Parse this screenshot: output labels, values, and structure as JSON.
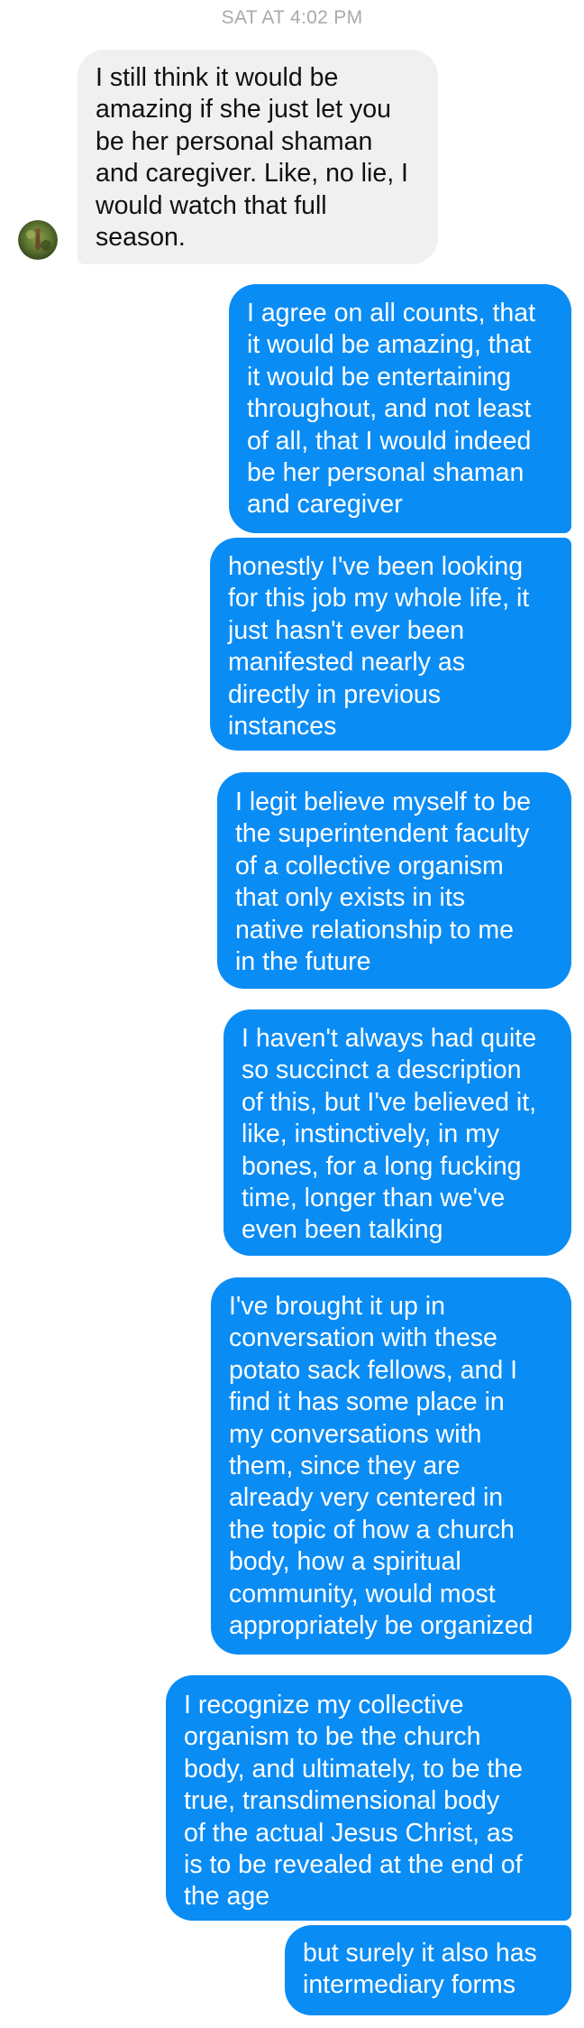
{
  "thread": {
    "timestamp": "SAT AT 4:02 PM"
  },
  "messages": [
    {
      "sender": "contact",
      "text": "I still think it would be\namazing if she just let you\nbe her personal shaman\nand caregiver. Like, no lie, I\nwould watch that full\nseason."
    },
    {
      "sender": "me",
      "text": "I agree on all counts, that\nit would be amazing, that\nit would be entertaining\nthroughout, and not least\nof all, that I would indeed\nbe her personal shaman\nand caregiver"
    },
    {
      "sender": "me",
      "text": "honestly I've been looking\nfor this job my whole life, it\njust hasn't ever been\nmanifested nearly as\ndirectly in previous\ninstances"
    },
    {
      "sender": "me",
      "text": "I legit believe myself to be\nthe superintendent faculty\nof a collective organism\nthat only exists in its\nnative relationship to me\nin the future"
    },
    {
      "sender": "me",
      "text": "I haven't always had quite\nso succinct a description\nof this, but I've believed it,\nlike, instinctively, in my\nbones, for a long fucking\ntime, longer than we've\neven been talking"
    },
    {
      "sender": "me",
      "text": "I've brought it up in\nconversation with these\npotato sack fellows, and I\nfind it has some place in\nmy conversations with\nthem, since they are\nalready very centered in\nthe topic of how a church\nbody, how a spiritual\ncommunity, would most\nappropriately be organized"
    },
    {
      "sender": "me",
      "text": "I recognize my collective\norganism to be the church\nbody, and ultimately, to be the\ntrue, transdimensional body\nof the actual Jesus Christ, as\nis to be revealed at the end of\nthe age"
    },
    {
      "sender": "me",
      "text": "but surely it also has\nintermediary forms"
    }
  ],
  "colors": {
    "outgoing_bubble": "#0a8cf5",
    "incoming_bubble": "#f1f0f0",
    "timestamp_text": "#a9a9a9"
  },
  "icons": {
    "contact_avatar": "avatar"
  }
}
